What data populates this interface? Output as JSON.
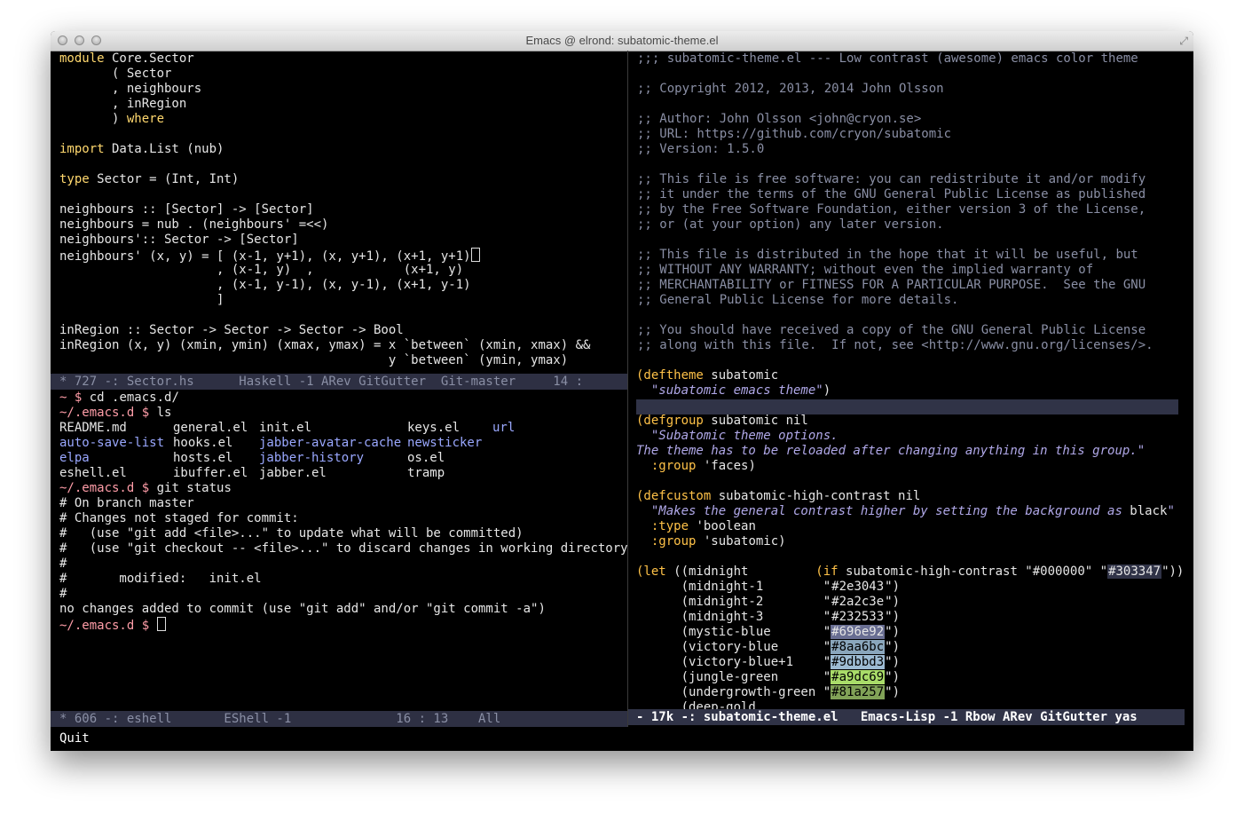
{
  "window": {
    "title": "Emacs @ elrond: subatomic-theme.el"
  },
  "colors": {
    "background": "#000000",
    "keyword": "#ffd86e",
    "comment": "#8a8fa5",
    "string": "#b0a8e8",
    "modeline_inactive_bg": "#2e3043",
    "modeline_active_bg": "#303347"
  },
  "haskell": {
    "lines": {
      "l0_kw": "module",
      "l0_rest": " Core.Sector",
      "l1": "       ( Sector",
      "l2": "       , neighbours",
      "l3": "       , inRegion",
      "l4_a": "       ) ",
      "l4_kw": "where",
      "l6_kw": "import",
      "l6_rest": " Data.List (nub)",
      "l8_kw": "type",
      "l8_rest": " Sector = (Int, Int)",
      "l10": "neighbours :: [Sector] -> [Sector]",
      "l11": "neighbours = nub . (neighbours' =<<)",
      "l12": "neighbours':: Sector -> [Sector]",
      "l13": "neighbours' (x, y) = [ (x-1, y+1), (x, y+1), (x+1, y+1)",
      "l14": "                     , (x-1, y)  ,            (x+1, y)",
      "l15": "                     , (x-1, y-1), (x, y-1), (x+1, y-1)",
      "l16": "                     ]",
      "l18": "inRegion :: Sector -> Sector -> Sector -> Bool",
      "l19": "inRegion (x, y) (xmin, ymin) (xmax, ymax) = x `between` (xmin, xmax) &&",
      "l20": "                                            y `between` (ymin, ymax)"
    },
    "modeline": "* 727 -: Sector.hs      Haskell -1 ARev GitGutter  Git-master     14 :"
  },
  "eshell": {
    "lines": {
      "e0_prompt": "~ $",
      "e0_cmd": " cd .emacs.d/",
      "e1_prompt": "~/.emacs.d $",
      "e1_cmd": " ls",
      "ls_col1": [
        "README.md",
        "auto-save-list",
        "elpa",
        "eshell.el"
      ],
      "ls_col2": [
        "general.el",
        "hooks.el",
        "hosts.el",
        "ibuffer.el"
      ],
      "ls_col3": [
        "init.el",
        "jabber-avatar-cache",
        "jabber-history",
        "jabber.el"
      ],
      "ls_col4": [
        "keys.el",
        "newsticker",
        "os.el",
        "tramp"
      ],
      "ls_col5": [
        "url",
        "",
        "",
        ""
      ],
      "e6_prompt": "~/.emacs.d $",
      "e6_cmd": " git status",
      "e7": "# On branch master",
      "e8": "# Changes not staged for commit:",
      "e9": "#   (use \"git add <file>...\" to update what will be committed)",
      "e10": "#   (use \"git checkout -- <file>...\" to discard changes in working directory)",
      "e11": "#",
      "e12": "#       modified:   init.el",
      "e13": "#",
      "e14": "no changes added to commit (use \"git add\" and/or \"git commit -a\")",
      "e15_prompt": "~/.emacs.d $"
    },
    "modeline": "* 606 -: eshell       EShell -1              16 : 13    All"
  },
  "elisp": {
    "lines": {
      "r0": ";;; subatomic-theme.el --- Low contrast (awesome) emacs color theme",
      "r2": ";; Copyright 2012, 2013, 2014 John Olsson",
      "r4": ";; Author: John Olsson <john@cryon.se>",
      "r5": ";; URL: https://github.com/cryon/subatomic",
      "r6": ";; Version: 1.5.0",
      "r8": ";; This file is free software: you can redistribute it and/or modify",
      "r9": ";; it under the terms of the GNU General Public License as published",
      "r10": ";; by the Free Software Foundation, either version 3 of the License,",
      "r11": ";; or (at your option) any later version.",
      "r13": ";; This file is distributed in the hope that it will be useful, but",
      "r14": ";; WITHOUT ANY WARRANTY; without even the implied warranty of",
      "r15": ";; MERCHANTABILITY or FITNESS FOR A PARTICULAR PURPOSE.  See the GNU",
      "r16": ";; General Public License for more details.",
      "r18": ";; You should have received a copy of the GNU General Public License",
      "r19": ";; along with this file.  If not, see <http://www.gnu.org/licenses/>.",
      "r21_kw": "(deftheme",
      "r21_rest": " subatomic",
      "r22_str": "  \"subatomic emacs theme\"",
      "r22_end": ")",
      "r24_kw": "(defgroup",
      "r24_rest": " subatomic nil",
      "r25": "  \"Subatomic theme options.",
      "r26": "The theme has to be reloaded after changing anything in this group.\"",
      "r27_kw": "  :group",
      "r27_rest": " 'faces)",
      "r29_kw": "(defcustom",
      "r29_rest": " subatomic-high-contrast nil",
      "r30_str": "  \"Makes the general contrast higher by setting the background as ",
      "r30_b": "black",
      "r30_q": "\"",
      "r31_kw": "  :type",
      "r31_rest": " 'boolean",
      "r32_kw": "  :group",
      "r32_rest": " 'subatomic)",
      "r34_kw": "(let",
      "r34_a": " ((midnight         ",
      "r34_if": "(if",
      "r34_b": " subatomic-high-contrast \"",
      "r34_c1": "#000000",
      "r34_mid": "\" \"",
      "r34_c2": "#303347",
      "r34_end": "\"))"
    },
    "palette": [
      {
        "name": "      (midnight-1       ",
        "hex": "#2e3043",
        "swatch": "#000000",
        "fg": "#e6e6e6"
      },
      {
        "name": "      (midnight-2       ",
        "hex": "#2a2c3e",
        "swatch": "#000000",
        "fg": "#e6e6e6"
      },
      {
        "name": "      (midnight-3       ",
        "hex": "#232533",
        "swatch": "#000000",
        "fg": "#e6e6e6"
      },
      {
        "name": "      (mystic-blue      ",
        "hex": "#696e92",
        "swatch": "#696e92",
        "fg": "#e6e6e6"
      },
      {
        "name": "      (victory-blue     ",
        "hex": "#8aa6bc",
        "swatch": "#8aa6bc",
        "fg": "#000000"
      },
      {
        "name": "      (victory-blue+1   ",
        "hex": "#9dbbd3",
        "swatch": "#9dbbd3",
        "fg": "#000000"
      },
      {
        "name": "      (jungle-green     ",
        "hex": "#a9dc69",
        "swatch": "#a9dc69",
        "fg": "#000000"
      },
      {
        "name": "      (undergrowth-green",
        "hex": "#81a257",
        "swatch": "#81a257",
        "fg": "#000000"
      }
    ],
    "partial_line": "      (deep-gold",
    "modeline": "- 17k -: subatomic-theme.el   Emacs-Lisp -1 Rbow ARev GitGutter yas"
  },
  "minibuffer": {
    "text": "Quit"
  }
}
